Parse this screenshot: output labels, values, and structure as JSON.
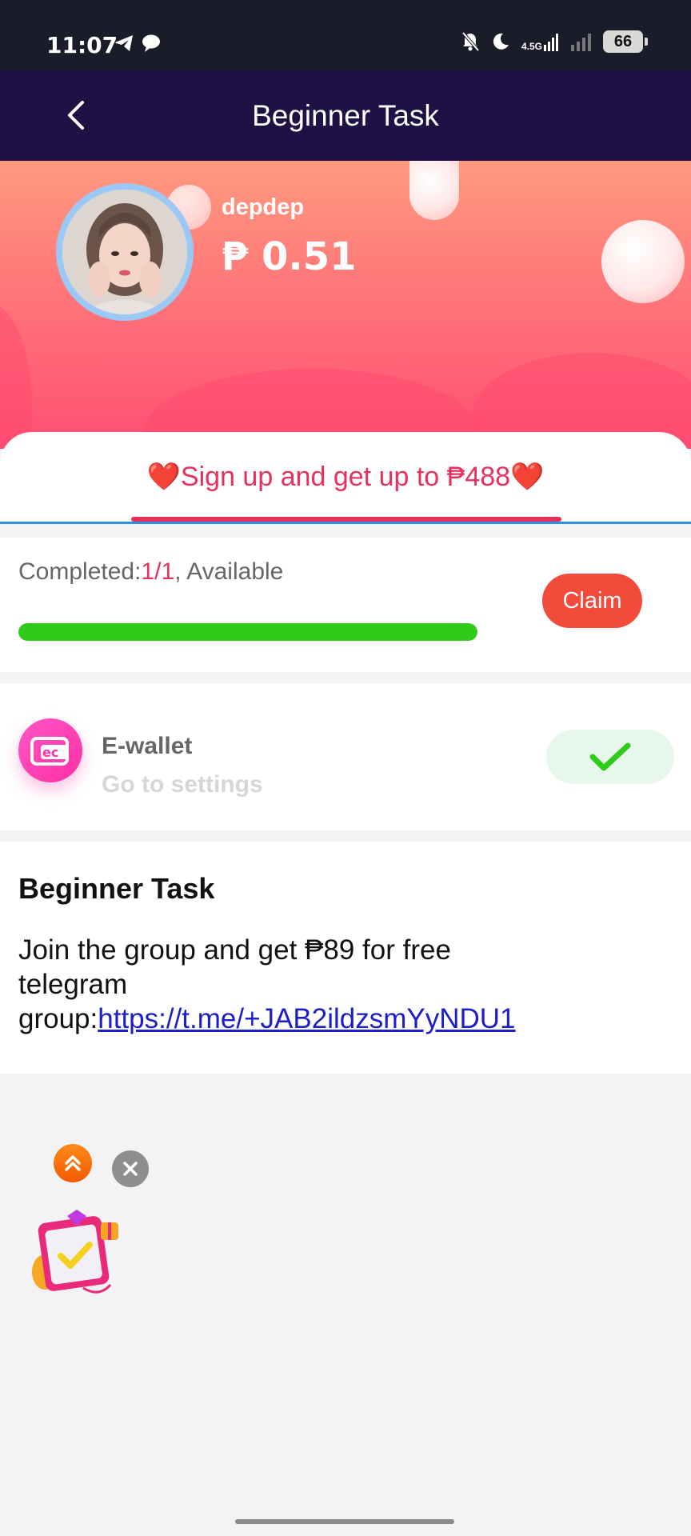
{
  "status_bar": {
    "time": "11:07",
    "left_icons": [
      "telegram-icon",
      "chat-bubble-icon"
    ],
    "right_icons": [
      "bell-off-icon",
      "moon-icon",
      "signal-4g-icon",
      "signal-bars-icon",
      "battery-icon"
    ],
    "network_label": "4.5G",
    "battery_level": "66"
  },
  "header": {
    "back_icon": "chevron-left-icon",
    "title": "Beginner Task"
  },
  "profile": {
    "username": "depdep",
    "balance": "₱ 0.51"
  },
  "tab": {
    "label": "❤️Sign up and get up to ₱488❤️"
  },
  "progress": {
    "completed_label": "Completed:",
    "completed_value": "1/1",
    "status": ", Available",
    "fraction": 1.0,
    "claim_label": "Claim"
  },
  "wallet": {
    "icon": "wallet-icon",
    "title": "E-wallet",
    "subtitle": "Go to settings",
    "done_icon": "checkmark-icon"
  },
  "description": {
    "title": "Beginner Task",
    "line1": "Join the group and get ₱89 for free",
    "line2": "telegram",
    "link_prefix": "group:",
    "link": "https://t.me/+JAB2ildzsmYyNDU1"
  },
  "floating_widget": {
    "expand_icon": "double-chevron-up-icon",
    "close_icon": "close-icon",
    "gift_icon": "gift-box-icon"
  },
  "colors": {
    "header_bg": "#1e1245",
    "accent": "#e8305e",
    "claim": "#f24b3b",
    "progress": "#2fcb1a",
    "link": "#1d1ec9"
  }
}
